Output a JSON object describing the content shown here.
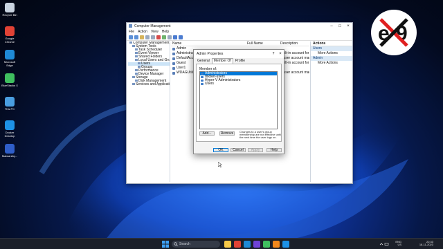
{
  "desktop": {
    "icons": [
      {
        "label": "Recycle Bin",
        "color": "#c9d3df"
      },
      {
        "label": "Google Chrome",
        "color": "#e14235"
      },
      {
        "label": "Microsoft Edge",
        "color": "#1f8ad6"
      },
      {
        "label": "BlueStacks X",
        "color": "#3fbf5f"
      },
      {
        "label": "This PC",
        "color": "#4a9ee0"
      },
      {
        "label": "Docker Desktop",
        "color": "#1d91e6"
      },
      {
        "label": "Malwareby...",
        "color": "#2f5ec9"
      }
    ]
  },
  "window": {
    "title": "Computer Management",
    "menu": [
      "File",
      "Action",
      "View",
      "Help"
    ],
    "tree": [
      {
        "label": "Computer Management (Local)",
        "indent": 0
      },
      {
        "label": "System Tools",
        "indent": 1
      },
      {
        "label": "Task Scheduler",
        "indent": 2
      },
      {
        "label": "Event Viewer",
        "indent": 2
      },
      {
        "label": "Shared Folders",
        "indent": 2
      },
      {
        "label": "Local Users and Groups",
        "indent": 2
      },
      {
        "label": "Users",
        "indent": 3,
        "selected": true
      },
      {
        "label": "Groups",
        "indent": 3
      },
      {
        "label": "Performance",
        "indent": 2
      },
      {
        "label": "Device Manager",
        "indent": 2
      },
      {
        "label": "Storage",
        "indent": 1
      },
      {
        "label": "Disk Management",
        "indent": 2
      },
      {
        "label": "Services and Applications",
        "indent": 1
      }
    ],
    "columns": {
      "name": "Name",
      "full_name": "Full Name",
      "description": "Description"
    },
    "rows": [
      {
        "name": "Admin",
        "desc": ""
      },
      {
        "name": "Administrator",
        "desc": "Built-in account for ad"
      },
      {
        "name": "DefaultAccount",
        "desc": "A user account manag"
      },
      {
        "name": "Guest",
        "desc": "Built-in account for gu"
      },
      {
        "name": "User1",
        "desc": ""
      },
      {
        "name": "WDAGUtilityAccount",
        "desc": "A user account manag"
      }
    ],
    "actions": {
      "title": "Actions",
      "sections": [
        {
          "header": "Users",
          "items": [
            "More Actions"
          ]
        },
        {
          "header": "Admin",
          "items": [
            "More Actions"
          ]
        }
      ]
    }
  },
  "dialog": {
    "title": "Admin Properties",
    "help": "?",
    "tabs": [
      "General",
      "Member Of",
      "Profile"
    ],
    "active_tab": 1,
    "member_of_label": "Member of:",
    "members": [
      "Administrators",
      "docker-users",
      "Hyper-V Administrators",
      "Users"
    ],
    "selected_index": 0,
    "add_label": "Add...",
    "remove_label": "Remove",
    "note": "Changes to a user's group membership are not effective until the next time the user logs on.",
    "ok_label": "OK",
    "cancel_label": "Cancel",
    "apply_label": "Apply",
    "help_label": "Help"
  },
  "taskbar": {
    "search_placeholder": "Search",
    "language": "ENG",
    "region": "US",
    "time": "22:33",
    "date": "18-11-2023",
    "apps": [
      "#f7c948",
      "#e14235",
      "#1f8ad6",
      "#6f43d6",
      "#3fbf5f",
      "#f2871c",
      "#1d91e6"
    ]
  }
}
